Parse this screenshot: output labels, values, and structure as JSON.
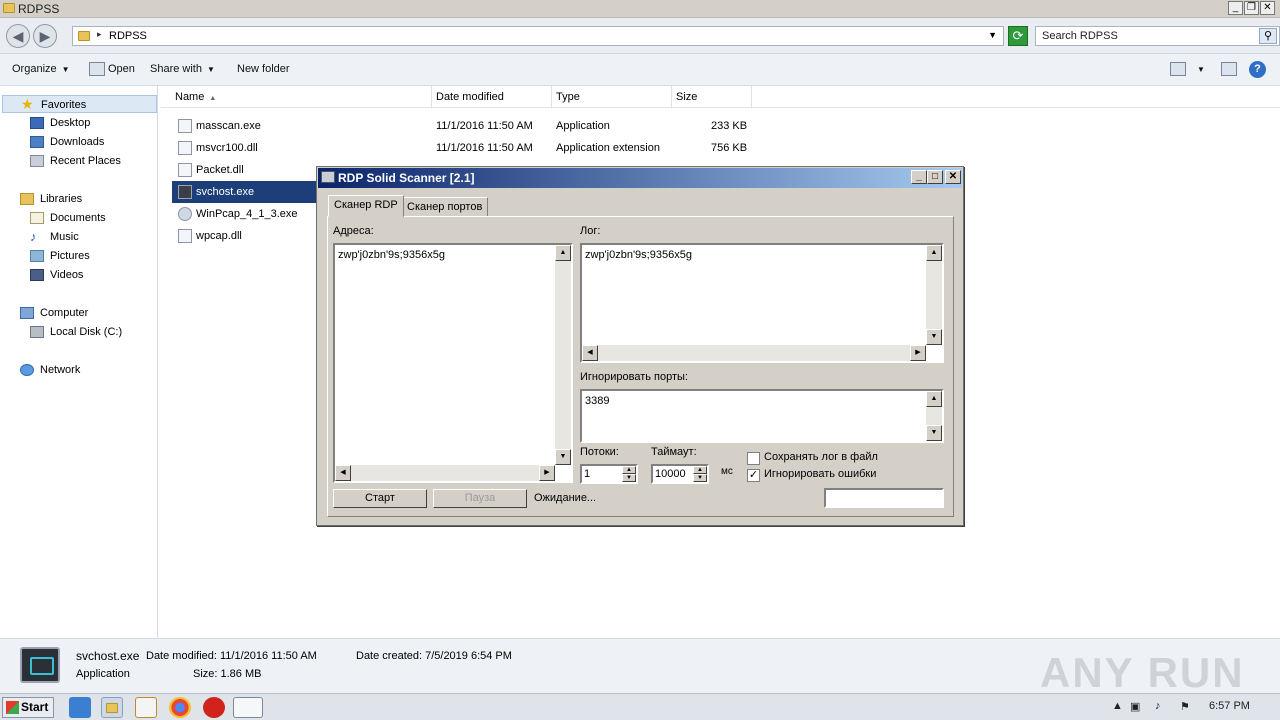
{
  "window": {
    "title": "RDPSS"
  },
  "address": {
    "path": "RDPSS",
    "search_placeholder": "Search RDPSS"
  },
  "toolbar": {
    "organize": "Organize",
    "open": "Open",
    "share_with": "Share with",
    "new_folder": "New folder"
  },
  "nav": {
    "favorites": "Favorites",
    "desktop": "Desktop",
    "downloads": "Downloads",
    "recent_places": "Recent Places",
    "libraries": "Libraries",
    "documents": "Documents",
    "music": "Music",
    "pictures": "Pictures",
    "videos": "Videos",
    "computer": "Computer",
    "local_disk": "Local Disk (C:)",
    "network": "Network"
  },
  "columns": {
    "name": "Name",
    "date_modified": "Date modified",
    "type": "Type",
    "size": "Size"
  },
  "files": [
    {
      "name": "masscan.exe",
      "date": "11/1/2016 11:50 AM",
      "type": "Application",
      "size": "233 KB"
    },
    {
      "name": "msvcr100.dll",
      "date": "11/1/2016 11:50 AM",
      "type": "Application extension",
      "size": "756 KB"
    },
    {
      "name": "Packet.dll"
    },
    {
      "name": "svchost.exe"
    },
    {
      "name": "WinPcap_4_1_3.exe"
    },
    {
      "name": "wpcap.dll"
    }
  ],
  "dialog": {
    "title": "RDP Solid Scanner [2.1]",
    "tab_rdp": "Сканер RDP",
    "tab_ports": "Сканер портов",
    "addresses_label": "Адреса:",
    "addresses_value": "zwp'j0zbn'9s;9356x5g",
    "log_label": "Лог:",
    "log_value": "zwp'j0zbn'9s;9356x5g",
    "ignore_ports_label": "Игнорировать порты:",
    "ignore_ports_value": "3389",
    "threads_label": "Потоки:",
    "threads_value": "1",
    "timeout_label": "Таймаут:",
    "timeout_value": "10000",
    "timeout_unit": "мс",
    "save_log_label": "Сохранять лог в файл",
    "save_log_checked": false,
    "ignore_errors_label": "Игнорировать ошибки",
    "ignore_errors_checked": true,
    "start_button": "Старт",
    "pause_button": "Пауза",
    "status": "Ожидание..."
  },
  "details": {
    "filename": "svchost.exe",
    "date_modified": "Date modified: 11/1/2016 11:50 AM",
    "date_created": "Date created: 7/5/2019 6:54 PM",
    "type": "Application",
    "size": "Size: 1.86 MB",
    "watermark": "ANY RUN"
  },
  "taskbar": {
    "start": "Start",
    "clock": "6:57 PM"
  }
}
